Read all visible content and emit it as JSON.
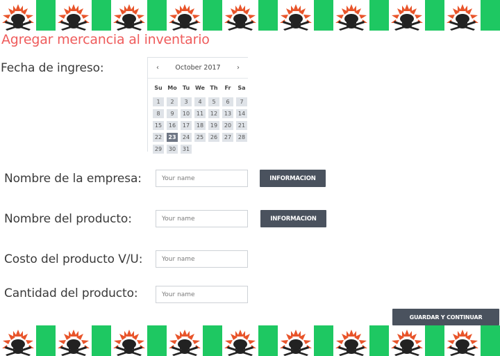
{
  "page": {
    "title": "Agregar mercancia al inventario"
  },
  "banner": {
    "logo_icon": "chef-hat-crossed-utensils-icon",
    "stripe_color": "#1ec862",
    "tile_count": 9
  },
  "form": {
    "fecha_label": "Fecha de ingreso:",
    "empresa_label": "Nombre de la empresa:",
    "producto_label": "Nombre del producto:",
    "costo_label": "Costo del producto V/U:",
    "cantidad_label": "Cantidad del producto:",
    "empresa_placeholder": "Your name",
    "producto_placeholder": "Your name",
    "costo_placeholder": "Your name",
    "cantidad_placeholder": "Your name",
    "info_button_1": "INFORMACION",
    "info_button_2": "INFORMACION",
    "submit_button": "GUARDAR Y CONTINUAR"
  },
  "calendar": {
    "month_label": "October 2017",
    "prev": "‹",
    "next": "›",
    "weekdays": [
      "Su",
      "Mo",
      "Tu",
      "We",
      "Th",
      "Fr",
      "Sa"
    ],
    "days": [
      1,
      2,
      3,
      4,
      5,
      6,
      7,
      8,
      9,
      10,
      11,
      12,
      13,
      14,
      15,
      16,
      17,
      18,
      19,
      20,
      21,
      22,
      23,
      24,
      25,
      26,
      27,
      28,
      29,
      30,
      31
    ],
    "selected_day": 23
  },
  "colors": {
    "title": "#ef5b5b",
    "button": "#4a525e",
    "accent_green": "#1ec862"
  }
}
